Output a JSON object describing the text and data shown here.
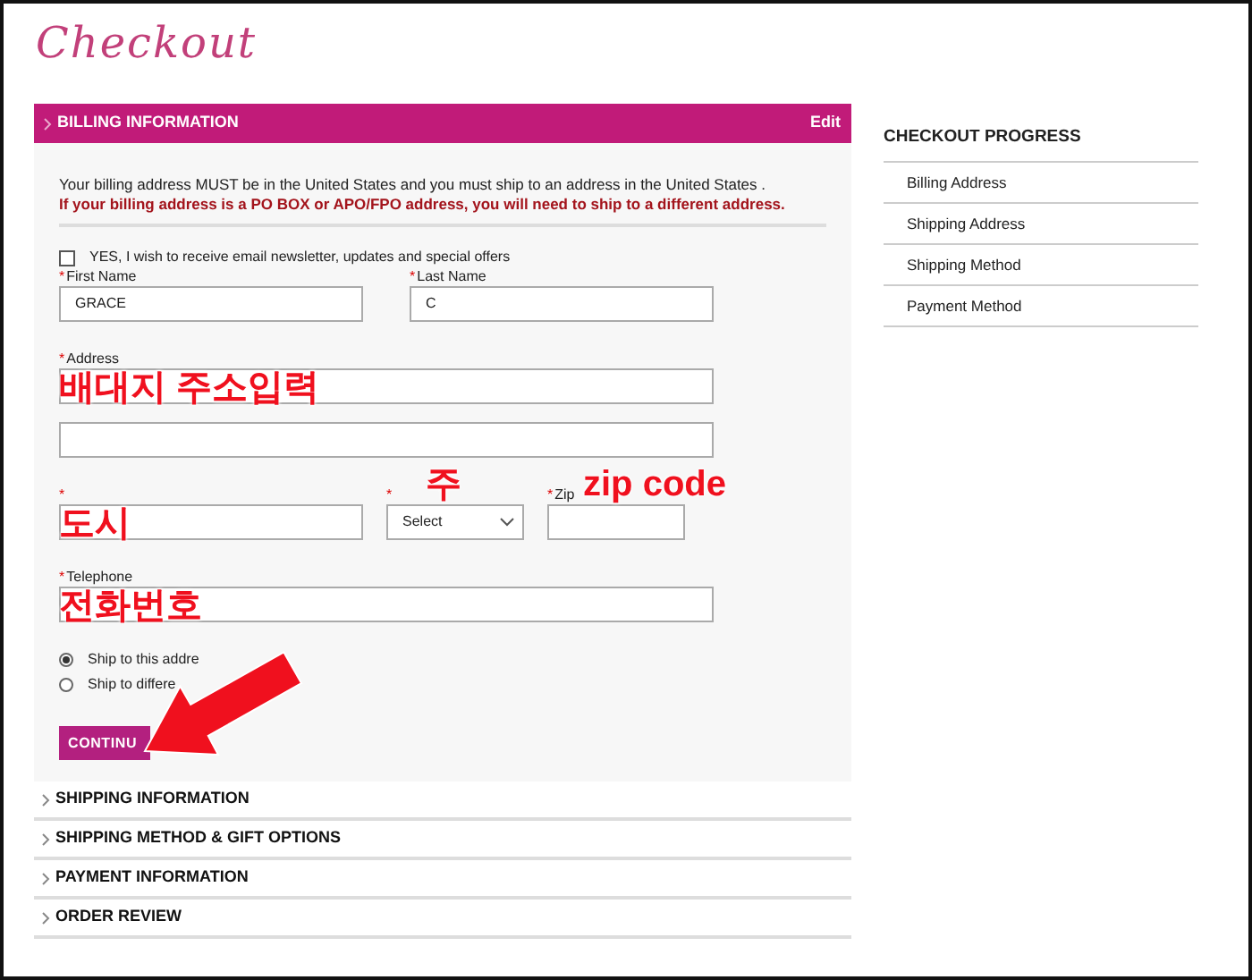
{
  "page_title": "Checkout",
  "billing": {
    "title": "BILLING INFORMATION",
    "edit": "Edit",
    "notice": "Your billing address MUST be in the United States and you must ship to an address in the United States .",
    "warning": "If your billing address is a PO BOX or APO/FPO address, you will need to ship to a different address.",
    "newsletter": {
      "label": "YES, I wish to receive email newsletter, updates and special offers",
      "checked": false
    },
    "rows": [
      [
        {
          "kind": "text",
          "mark": "*",
          "label": "First Name",
          "value": "GRACE"
        },
        {
          "kind": "text",
          "mark": "*",
          "label": "Last Name",
          "value": "C"
        }
      ],
      [
        {
          "kind": "text",
          "mark": "*",
          "label": "Address",
          "annotation": "배대지 주소입력"
        }
      ],
      [
        {
          "kind": "text"
        }
      ],
      [
        {
          "kind": "text",
          "mark": "*",
          "annotation": "도시"
        },
        {
          "kind": "select",
          "mark": "*",
          "value": "Select",
          "annotation": "주"
        },
        {
          "kind": "text",
          "mark": "*",
          "label": "Zip",
          "annotation": "zip code"
        }
      ],
      [
        {
          "kind": "text",
          "mark": "*",
          "label": "Telephone",
          "annotation": "전화번호"
        }
      ]
    ],
    "ship_options": [
      {
        "label": "Ship to this addre",
        "selected": true
      },
      {
        "label": "Ship to differe",
        "selected": false
      }
    ],
    "button": "CONTINU"
  },
  "sections": [
    {
      "title": "SHIPPING INFORMATION"
    },
    {
      "title": "SHIPPING METHOD & GIFT OPTIONS"
    },
    {
      "title": "PAYMENT INFORMATION"
    },
    {
      "title": "ORDER REVIEW"
    }
  ],
  "progress": {
    "title": "CHECKOUT PROGRESS",
    "items": [
      "Billing Address",
      "Shipping Address",
      "Shipping Method",
      "Payment Method"
    ]
  }
}
